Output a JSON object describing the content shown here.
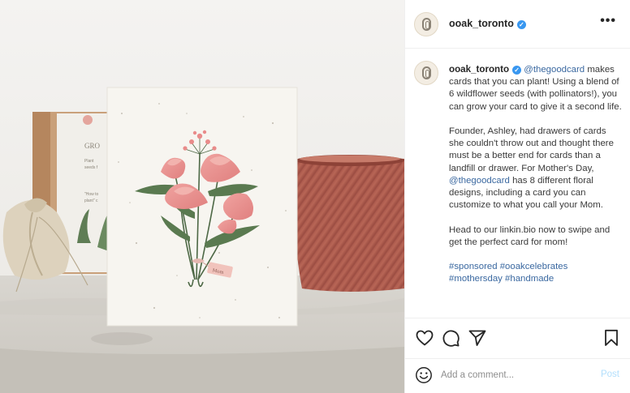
{
  "post": {
    "image_alt": "Plantable card with pink floral bouquet",
    "card_tag_text": "Mom",
    "box_text_title": "GRO",
    "box_text_line1": "Plant",
    "box_text_line2": "seeds f",
    "box_text_line3": "\"How to",
    "box_text_line4": "plant\" c"
  },
  "header": {
    "username": "ooak_toronto",
    "verified_mark": "✓",
    "more_label": "•••"
  },
  "caption": {
    "username": "ooak_toronto",
    "verified_mark": "✓",
    "mention_1": "@thegoodcard",
    "text_1": " makes cards that you can plant! Using a blend of 6 wildflower seeds (with pollinators!), you can grow your card to give it a second life.",
    "text_2a": "Founder, Ashley, had drawers of cards she couldn't throw out and thought there must be a better end for cards than a landfill or drawer. For Mother's Day, ",
    "mention_2": "@thegoodcard",
    "text_2b": " has 8 different floral designs, including a card you can customize to what you call your Mom.",
    "text_3": "Head to our linkin.bio now to swipe and get the perfect card for mom!",
    "tag_1": "#sponsored",
    "tag_2": "#ooakcelebrates",
    "tag_3": "#mothersday",
    "tag_4": "#handmade"
  },
  "actions": {
    "like_icon": "heart-icon",
    "comment_icon": "comment-icon",
    "share_icon": "paper-plane-icon",
    "save_icon": "bookmark-icon"
  },
  "comment_bar": {
    "placeholder": "Add a comment...",
    "post_label": "Post",
    "post_color": "#b2dffc"
  },
  "colors": {
    "verified": "#3897f0",
    "link": "#3a68a0"
  }
}
